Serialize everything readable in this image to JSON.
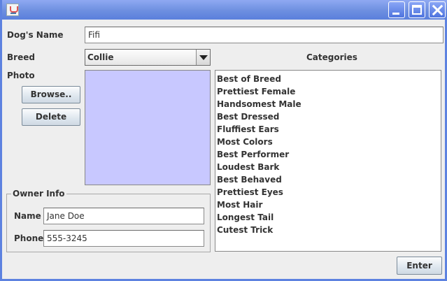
{
  "form": {
    "dog_name_label": "Dog's Name",
    "dog_name_value": "Fifi",
    "breed_label": "Breed",
    "breed_value": "Collie",
    "photo_label": "Photo",
    "browse_label": "Browse..",
    "delete_label": "Delete",
    "categories_label": "Categories",
    "categories": [
      "Best of Breed",
      "Prettiest Female",
      "Handsomest Male",
      "Best Dressed",
      "Fluffiest Ears",
      "Most Colors",
      "Best Performer",
      "Loudest Bark",
      "Best Behaved",
      "Prettiest Eyes",
      "Most Hair",
      "Longest Tail",
      "Cutest Trick"
    ],
    "owner_group_label": "Owner Info",
    "owner_name_label": "Name",
    "owner_name_value": "Jane Doe",
    "owner_phone_label": "Phone",
    "owner_phone_value": "555-3245",
    "enter_label": "Enter"
  },
  "colors": {
    "photo_background": "#c8c8ff",
    "titlebar": "#6d8fe0"
  },
  "icons": {
    "app": "java-cup-icon",
    "minimize": "minimize-icon",
    "maximize": "maximize-icon",
    "close": "close-icon",
    "dropdown": "chevron-down-icon"
  }
}
